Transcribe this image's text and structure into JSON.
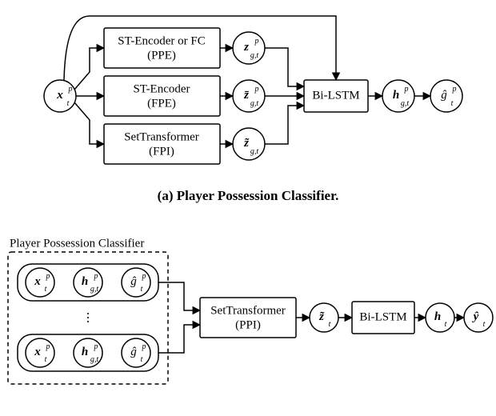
{
  "diagramA": {
    "input": {
      "label": "x",
      "sub": "t",
      "sup": "p",
      "bold": true
    },
    "ppe": {
      "line1": "ST-Encoder or FC",
      "line2": "(PPE)"
    },
    "fpe": {
      "line1": "ST-Encoder",
      "line2": "(FPE)"
    },
    "fpi": {
      "line1": "SetTransformer",
      "line2": "(FPI)"
    },
    "z_ppe": {
      "label": "z",
      "sub": "g,t",
      "sup": "p",
      "bold": true
    },
    "z_fpe": {
      "label": "z̄",
      "sub": "g,t",
      "sup": "p",
      "bold": true
    },
    "z_fpi": {
      "label": "z̃",
      "sub": "g,t",
      "sup": "",
      "bold": true
    },
    "bilstm": "Bi-LSTM",
    "h": {
      "label": "h",
      "sub": "g,t",
      "sup": "p",
      "bold": true
    },
    "g": {
      "label": "ĝ",
      "sub": "t",
      "sup": "p",
      "bold": false
    },
    "caption": "(a) Player Possession Classifier."
  },
  "diagramB": {
    "groupTitle": "Player Possession Classifier",
    "cells": {
      "x": {
        "label": "x",
        "sub": "t",
        "sup": "p",
        "bold": true
      },
      "h": {
        "label": "h",
        "sub": "g,t",
        "sup": "p",
        "bold": true
      },
      "g": {
        "label": "ĝ",
        "sub": "t",
        "sup": "p",
        "bold": false
      }
    },
    "dots": "⋮",
    "ppi": {
      "line1": "SetTransformer",
      "line2": "(PPI)"
    },
    "z": {
      "label": "z̃",
      "sub": "t",
      "sup": "",
      "bold": true
    },
    "bilstm": "Bi-LSTM",
    "hout": {
      "label": "h",
      "sub": "t",
      "sup": "",
      "bold": true
    },
    "y": {
      "label": "ŷ",
      "sub": "t",
      "sup": "",
      "bold": true
    }
  },
  "chart_data": {
    "type": "diagram",
    "description": "Two-part block diagram. Part (a): Player Possession Classifier — input vector x_t^p is fed to three parallel encoders (PPE: ST-Encoder or FC; FPE: ST-Encoder; FPI: SetTransformer) yielding z_{g,t}^p, z̄_{g,t}^p, z̃_{g,t}. These plus a skip connection from x_t^p go into a Bi-LSTM producing h_{g,t}^p and finally ĝ_t^p. Part (b): The Player Possession Classifier outputs (x_t^p, h_{g,t}^p, ĝ_t^p) for all players are grouped, passed through SetTransformer (PPI) giving z̃_t, then Bi-LSTM giving h_t, then ŷ_t."
  }
}
